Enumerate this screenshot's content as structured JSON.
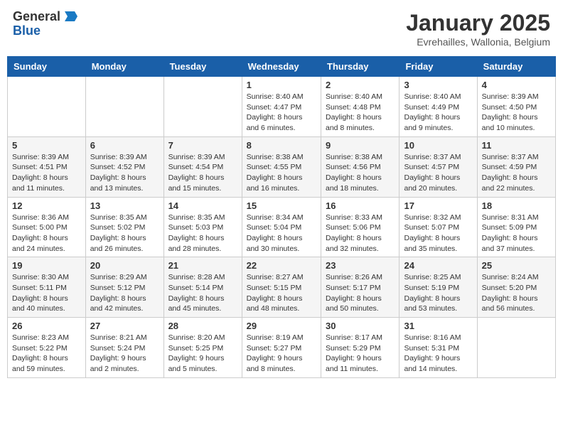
{
  "header": {
    "logo_general": "General",
    "logo_blue": "Blue",
    "month": "January 2025",
    "location": "Evrehailles, Wallonia, Belgium"
  },
  "weekdays": [
    "Sunday",
    "Monday",
    "Tuesday",
    "Wednesday",
    "Thursday",
    "Friday",
    "Saturday"
  ],
  "weeks": [
    [
      {
        "day": "",
        "info": ""
      },
      {
        "day": "",
        "info": ""
      },
      {
        "day": "",
        "info": ""
      },
      {
        "day": "1",
        "info": "Sunrise: 8:40 AM\nSunset: 4:47 PM\nDaylight: 8 hours\nand 6 minutes."
      },
      {
        "day": "2",
        "info": "Sunrise: 8:40 AM\nSunset: 4:48 PM\nDaylight: 8 hours\nand 8 minutes."
      },
      {
        "day": "3",
        "info": "Sunrise: 8:40 AM\nSunset: 4:49 PM\nDaylight: 8 hours\nand 9 minutes."
      },
      {
        "day": "4",
        "info": "Sunrise: 8:39 AM\nSunset: 4:50 PM\nDaylight: 8 hours\nand 10 minutes."
      }
    ],
    [
      {
        "day": "5",
        "info": "Sunrise: 8:39 AM\nSunset: 4:51 PM\nDaylight: 8 hours\nand 11 minutes."
      },
      {
        "day": "6",
        "info": "Sunrise: 8:39 AM\nSunset: 4:52 PM\nDaylight: 8 hours\nand 13 minutes."
      },
      {
        "day": "7",
        "info": "Sunrise: 8:39 AM\nSunset: 4:54 PM\nDaylight: 8 hours\nand 15 minutes."
      },
      {
        "day": "8",
        "info": "Sunrise: 8:38 AM\nSunset: 4:55 PM\nDaylight: 8 hours\nand 16 minutes."
      },
      {
        "day": "9",
        "info": "Sunrise: 8:38 AM\nSunset: 4:56 PM\nDaylight: 8 hours\nand 18 minutes."
      },
      {
        "day": "10",
        "info": "Sunrise: 8:37 AM\nSunset: 4:57 PM\nDaylight: 8 hours\nand 20 minutes."
      },
      {
        "day": "11",
        "info": "Sunrise: 8:37 AM\nSunset: 4:59 PM\nDaylight: 8 hours\nand 22 minutes."
      }
    ],
    [
      {
        "day": "12",
        "info": "Sunrise: 8:36 AM\nSunset: 5:00 PM\nDaylight: 8 hours\nand 24 minutes."
      },
      {
        "day": "13",
        "info": "Sunrise: 8:35 AM\nSunset: 5:02 PM\nDaylight: 8 hours\nand 26 minutes."
      },
      {
        "day": "14",
        "info": "Sunrise: 8:35 AM\nSunset: 5:03 PM\nDaylight: 8 hours\nand 28 minutes."
      },
      {
        "day": "15",
        "info": "Sunrise: 8:34 AM\nSunset: 5:04 PM\nDaylight: 8 hours\nand 30 minutes."
      },
      {
        "day": "16",
        "info": "Sunrise: 8:33 AM\nSunset: 5:06 PM\nDaylight: 8 hours\nand 32 minutes."
      },
      {
        "day": "17",
        "info": "Sunrise: 8:32 AM\nSunset: 5:07 PM\nDaylight: 8 hours\nand 35 minutes."
      },
      {
        "day": "18",
        "info": "Sunrise: 8:31 AM\nSunset: 5:09 PM\nDaylight: 8 hours\nand 37 minutes."
      }
    ],
    [
      {
        "day": "19",
        "info": "Sunrise: 8:30 AM\nSunset: 5:11 PM\nDaylight: 8 hours\nand 40 minutes."
      },
      {
        "day": "20",
        "info": "Sunrise: 8:29 AM\nSunset: 5:12 PM\nDaylight: 8 hours\nand 42 minutes."
      },
      {
        "day": "21",
        "info": "Sunrise: 8:28 AM\nSunset: 5:14 PM\nDaylight: 8 hours\nand 45 minutes."
      },
      {
        "day": "22",
        "info": "Sunrise: 8:27 AM\nSunset: 5:15 PM\nDaylight: 8 hours\nand 48 minutes."
      },
      {
        "day": "23",
        "info": "Sunrise: 8:26 AM\nSunset: 5:17 PM\nDaylight: 8 hours\nand 50 minutes."
      },
      {
        "day": "24",
        "info": "Sunrise: 8:25 AM\nSunset: 5:19 PM\nDaylight: 8 hours\nand 53 minutes."
      },
      {
        "day": "25",
        "info": "Sunrise: 8:24 AM\nSunset: 5:20 PM\nDaylight: 8 hours\nand 56 minutes."
      }
    ],
    [
      {
        "day": "26",
        "info": "Sunrise: 8:23 AM\nSunset: 5:22 PM\nDaylight: 8 hours\nand 59 minutes."
      },
      {
        "day": "27",
        "info": "Sunrise: 8:21 AM\nSunset: 5:24 PM\nDaylight: 9 hours\nand 2 minutes."
      },
      {
        "day": "28",
        "info": "Sunrise: 8:20 AM\nSunset: 5:25 PM\nDaylight: 9 hours\nand 5 minutes."
      },
      {
        "day": "29",
        "info": "Sunrise: 8:19 AM\nSunset: 5:27 PM\nDaylight: 9 hours\nand 8 minutes."
      },
      {
        "day": "30",
        "info": "Sunrise: 8:17 AM\nSunset: 5:29 PM\nDaylight: 9 hours\nand 11 minutes."
      },
      {
        "day": "31",
        "info": "Sunrise: 8:16 AM\nSunset: 5:31 PM\nDaylight: 9 hours\nand 14 minutes."
      },
      {
        "day": "",
        "info": ""
      }
    ]
  ]
}
